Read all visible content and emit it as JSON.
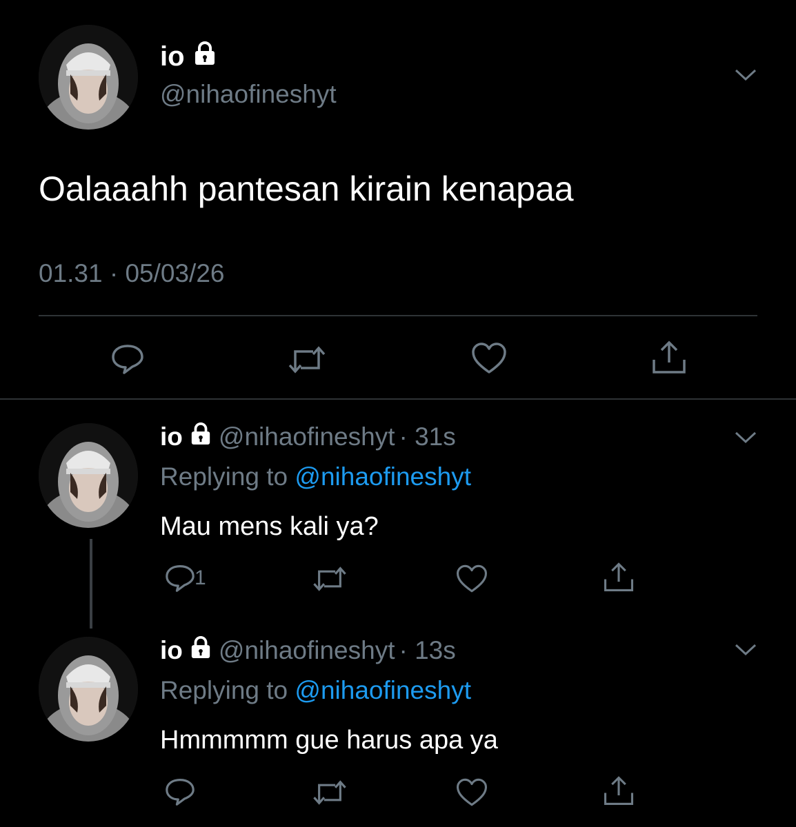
{
  "main_tweet": {
    "display_name": "io",
    "handle": "@nihaofineshyt",
    "text": "Oalaaahh pantesan kirain kenapaa",
    "timestamp": "01.31 · 05/03/26"
  },
  "replies": [
    {
      "display_name": "io",
      "handle": "@nihaofineshyt",
      "time": "· 31s",
      "replying_label": "Replying to",
      "replying_handle": "@nihaofineshyt",
      "text": "Mau mens kali ya?",
      "reply_count": "1"
    },
    {
      "display_name": "io",
      "handle": "@nihaofineshyt",
      "time": "· 13s",
      "replying_label": "Replying to",
      "replying_handle": "@nihaofineshyt",
      "text": "Hmmmmm gue harus apa ya",
      "reply_count": ""
    }
  ],
  "icons": [
    "lock-icon",
    "chevron-down-icon",
    "reply-icon",
    "retweet-icon",
    "like-icon",
    "share-icon"
  ],
  "colors": {
    "background": "#000000",
    "muted": "#6e7b86",
    "link": "#1d9bf0",
    "divider": "#2f3336"
  }
}
